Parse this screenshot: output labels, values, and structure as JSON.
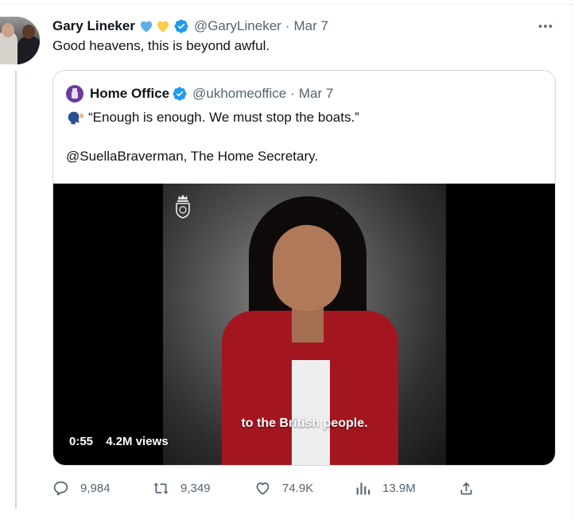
{
  "tweet": {
    "author_name": "Gary Lineker",
    "author_handle": "@GaryLineker",
    "separator": "·",
    "date": "Mar 7",
    "hearts": [
      "blue-heart-icon",
      "yellow-heart-icon"
    ],
    "text": "Good heavens, this is beyond awful."
  },
  "quote": {
    "author_name": "Home Office",
    "author_handle": "@ukhomeoffice",
    "separator": "·",
    "date": "Mar 7",
    "line1": "“Enough is enough. We must stop the boats.”",
    "line2": "@SuellaBraverman, The Home Secretary.",
    "video": {
      "caption": "to the British people.",
      "duration": "0:55",
      "views": "4.2M views"
    }
  },
  "actions": {
    "replies": "9,984",
    "retweets": "9,349",
    "likes": "74.9K",
    "views": "13.9M"
  },
  "colors": {
    "verified": "#1d9bf0",
    "text": "#0f1419",
    "secondary": "#536471",
    "border": "#cfd9de",
    "blue_heart": "#5daeeb",
    "yellow_heart": "#ffcc4d"
  }
}
